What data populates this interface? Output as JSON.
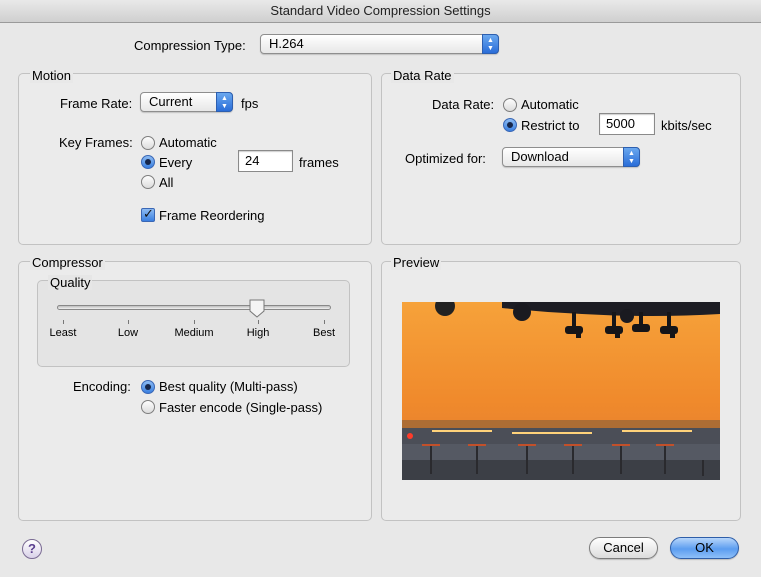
{
  "window": {
    "title": "Standard Video Compression Settings"
  },
  "compression_type": {
    "label": "Compression Type:",
    "value": "H.264"
  },
  "motion": {
    "title": "Motion",
    "frame_rate_label": "Frame Rate:",
    "frame_rate_value": "Current",
    "frame_rate_unit": "fps",
    "key_frames_label": "Key Frames:",
    "key_frames_options": [
      "Automatic",
      "Every",
      "All"
    ],
    "key_frames_selected": "Every",
    "key_frames_every_value": "24",
    "key_frames_unit": "frames",
    "frame_reordering_label": "Frame Reordering",
    "frame_reordering_checked": true
  },
  "data_rate": {
    "title": "Data Rate",
    "label": "Data Rate:",
    "options": [
      "Automatic",
      "Restrict to"
    ],
    "selected": "Restrict to",
    "restrict_value": "5000",
    "unit": "kbits/sec",
    "optimized_label": "Optimized for:",
    "optimized_value": "Download"
  },
  "compressor": {
    "title": "Compressor",
    "quality_title": "Quality",
    "quality_ticks": [
      "Least",
      "Low",
      "Medium",
      "High",
      "Best"
    ],
    "quality_value": "High",
    "encoding_label": "Encoding:",
    "encoding_options": [
      "Best quality (Multi-pass)",
      "Faster encode (Single-pass)"
    ],
    "encoding_selected": "Best quality (Multi-pass)"
  },
  "preview": {
    "title": "Preview"
  },
  "buttons": {
    "help": "?",
    "cancel": "Cancel",
    "ok": "OK"
  },
  "colors": {
    "accent": "#3a7fe0",
    "background": "#e8e8e8",
    "sky_orange": "#f0942a"
  }
}
